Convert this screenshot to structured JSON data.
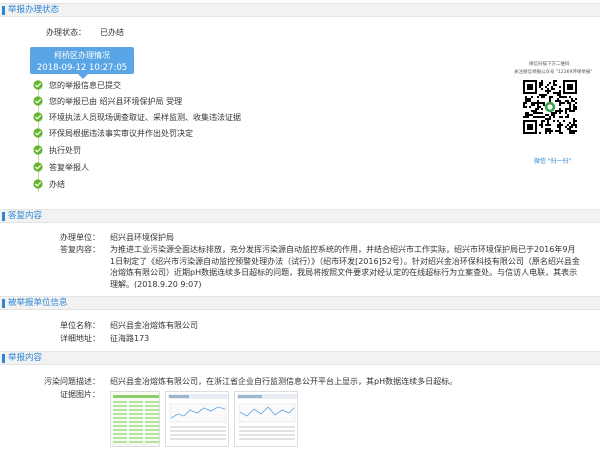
{
  "sections": {
    "status": "举报办理状态",
    "reply": "答复内容",
    "reported_unit": "被举报单位信息",
    "report": "举报内容"
  },
  "status": {
    "label": "办理状态：",
    "value": "已办结",
    "box_line1": "柯桥区办理情况",
    "box_line2": "2018-09-12 10:27:05",
    "steps": [
      "您的举报信息已提交",
      "您的举报已由 绍兴县环境保护局 受理",
      "环境执法人员现场调查取证、采样监测、收集违法证据",
      "环保局根据违法事实审议并作出处罚决定",
      "执行处罚",
      "答复举报人",
      "办结"
    ]
  },
  "qr": {
    "caption1": "微信扫描下方二维码",
    "caption2": "关注微信举报公众号 \"12369环保举报\"",
    "foot": "微信 \"扫一扫\"",
    "icon": "qr-code-icon"
  },
  "reply": {
    "unit_label": "办理单位：",
    "unit_value": "绍兴县环境保护局",
    "content_label": "答复内容：",
    "content_value": "为推进工业污染源全面达标排放，充分发挥污染源自动监控系统的作用，并结合绍兴市工作实际，绍兴市环境保护局已于2016年9月1日制定了《绍兴市污染源自动监控预警处理办法（试行）》（绍市环发[2016]52号）。针对绍兴金冶环保科技有限公司（原名绍兴县金冶熔炼有限公司）近期pH数据连续多日超标的问题，我局将按照文件要求对经认定的在线超标行为立案查处。与信访人电联，其表示理解。(2018.9.20 9:07)"
  },
  "reported_unit": {
    "name_label": "单位名称：",
    "name_value": "绍兴县金冶熔炼有限公司",
    "addr_label": "详细地址：",
    "addr_value": "征海路173"
  },
  "report": {
    "desc_label": "污染问题描述：",
    "desc_value": "绍兴县金冶熔炼有限公司，在浙江省企业自行监测信息公开平台上显示，其pH数据连续多日超标。",
    "photo_label": "证据图片："
  },
  "colors": {
    "accent": "#2e86d6",
    "status_box": "#5aa5e6",
    "check": "#66b32e"
  }
}
